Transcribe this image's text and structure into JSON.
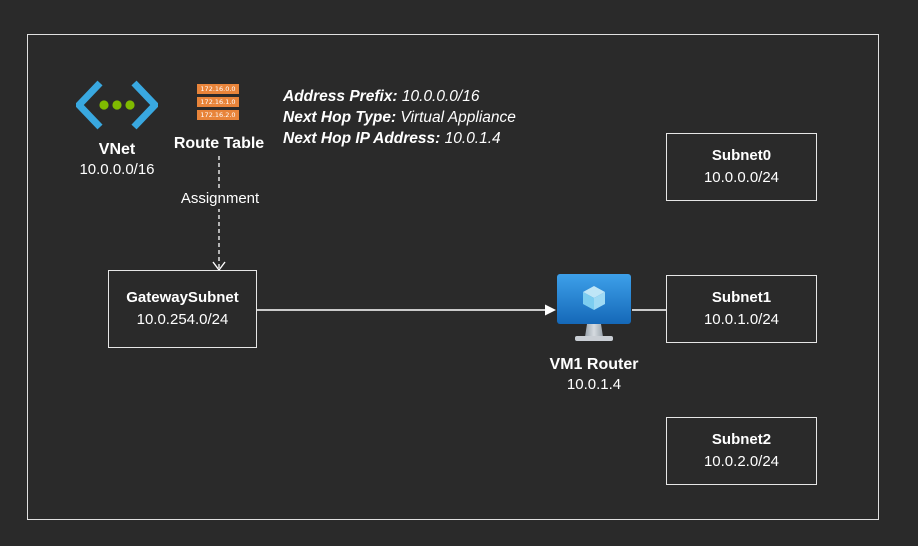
{
  "vnet": {
    "name": "VNet",
    "cidr": "10.0.0.0/16"
  },
  "route_table": {
    "name": "Route Table",
    "icon_rows": [
      "172.16.0.0",
      "172.16.1.0",
      "172.16.2.0"
    ],
    "assignment_label": "Assignment"
  },
  "route": {
    "address_prefix_label": "Address Prefix:",
    "address_prefix_value": "10.0.0.0/16",
    "next_hop_type_label": "Next Hop Type:",
    "next_hop_type_value": "Virtual Appliance",
    "next_hop_ip_label": "Next Hop IP Address:",
    "next_hop_ip_value": "10.0.1.4"
  },
  "gateway_subnet": {
    "name": "GatewaySubnet",
    "cidr": "10.0.254.0/24"
  },
  "router": {
    "name": "VM1 Router",
    "ip": "10.0.1.4"
  },
  "subnets": [
    {
      "name": "Subnet0",
      "cidr": "10.0.0.0/24"
    },
    {
      "name": "Subnet1",
      "cidr": "10.0.1.0/24"
    },
    {
      "name": "Subnet2",
      "cidr": "10.0.2.0/24"
    }
  ],
  "colors": {
    "background": "#2a2a2a",
    "vnet_icon_blue": "#39a8e0",
    "vnet_icon_dots": "#7fba00",
    "route_table_orange": "#e8843a",
    "vm_monitor_blue": "#1f8ad6"
  }
}
